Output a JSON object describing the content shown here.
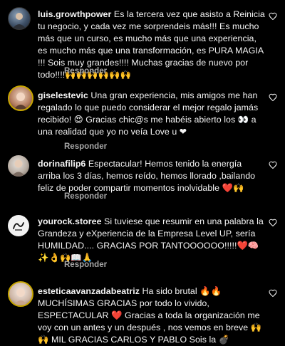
{
  "comments": [
    {
      "username": "luis.growthpower",
      "text": "Es la tercera vez que asisto a Reinicia tu negocio, y cada vez me sorprendeis más!!! Es mucho más que un curso, es mucho más que una experiencia, es mucho más que una transformación, es PURA MAGIA !!! Sois muy grandes!!!! Muchas gracias de nuevo por todo!!!!🙌🙌🙌🙌🙌🙌",
      "reply_label": "Responder",
      "avatar_icon": "profile-photo-icon"
    },
    {
      "username": "giselestevic",
      "text": "Una gran experiencia, mis amigos me han regalado lo que puedo considerar el mejor regalo jamás recibido! 😍 Gracias chic@s me habéis abierto los 👀 a una realidad que yo no veía Love u ❤",
      "reply_label": "Responder",
      "avatar_icon": "profile-photo-icon"
    },
    {
      "username": "dorinafilip6",
      "text": "Espectacular! Hemos tenido la energía arriba los 3 días, hemos reído, hemos llorado ,bailando feliz de poder compartir momentos inolvidable ❤️🙌",
      "reply_label": "Responder",
      "avatar_icon": "profile-photo-icon"
    },
    {
      "username": "yourock.storee",
      "text": "Si tuviese que resumir en una palabra la Grandeza y eXperiencia de la Empresa Level UP, sería HUMILDAD.... GRACIAS POR TANTOOOOOO!!!!!❤️🧠✨👌🙌📖🙏",
      "reply_label": "Responder",
      "avatar_icon": "logo-avatar-icon"
    },
    {
      "username": "esteticaavanzadabeatriz",
      "text": "Ha sido brutal 🔥🔥 MUCHÍSIMAS GRACIAS por todo lo vivido, ESPECTACULAR ❤️ Gracias a toda la organización me voy con un antes y un después , nos vemos en breve 🙌🙌 MIL GRACIAS CARLOS Y PABLO Sois la 💣",
      "reply_label": "",
      "avatar_icon": "profile-photo-icon"
    }
  ],
  "colors": {
    "background": "#000000",
    "text": "#f5f5f5",
    "muted": "#a8a8a8"
  }
}
